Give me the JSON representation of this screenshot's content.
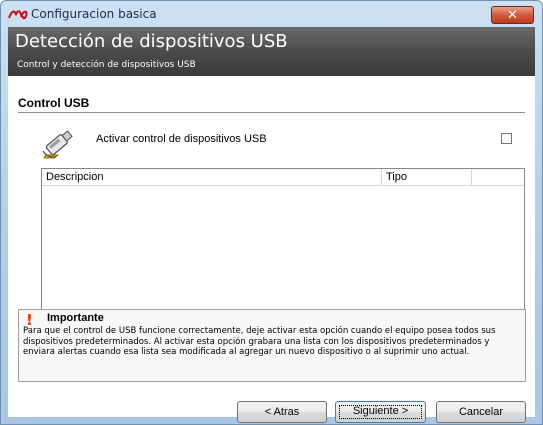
{
  "window": {
    "title": "Configuracion basica",
    "close_glyph": "✕"
  },
  "header": {
    "title": "Detección de dispositivos USB",
    "subtitle": "Control y detección de dispositivos USB"
  },
  "section": {
    "title": "Control USB",
    "checkbox_label": "Activar control de dispositivos USB",
    "checkbox_checked": false,
    "icon": "usb-drive-icon"
  },
  "list": {
    "columns": [
      "Descripcion",
      "Tipo",
      ""
    ],
    "rows": []
  },
  "important": {
    "icon": "exclamation-icon",
    "icon_glyph": "!",
    "title": "Importante",
    "text": "Para que el control de USB funcione correctamente, deje activar esta opción cuando el equipo posea todos sus dispositivos predeterminados. Al activar esta opción grabara una lista con los dispositivos predeterminados y enviara alertas cuando esa lista sea modificada al agregar un nuevo dispositivo o al suprimir uno actual."
  },
  "buttons": {
    "back": "< Atras",
    "next": "Siguiente >",
    "cancel": "Cancelar"
  },
  "colors": {
    "header_bg": "#4b4b4b",
    "close_button": "#c84a2f",
    "important_icon": "#e23c00"
  }
}
